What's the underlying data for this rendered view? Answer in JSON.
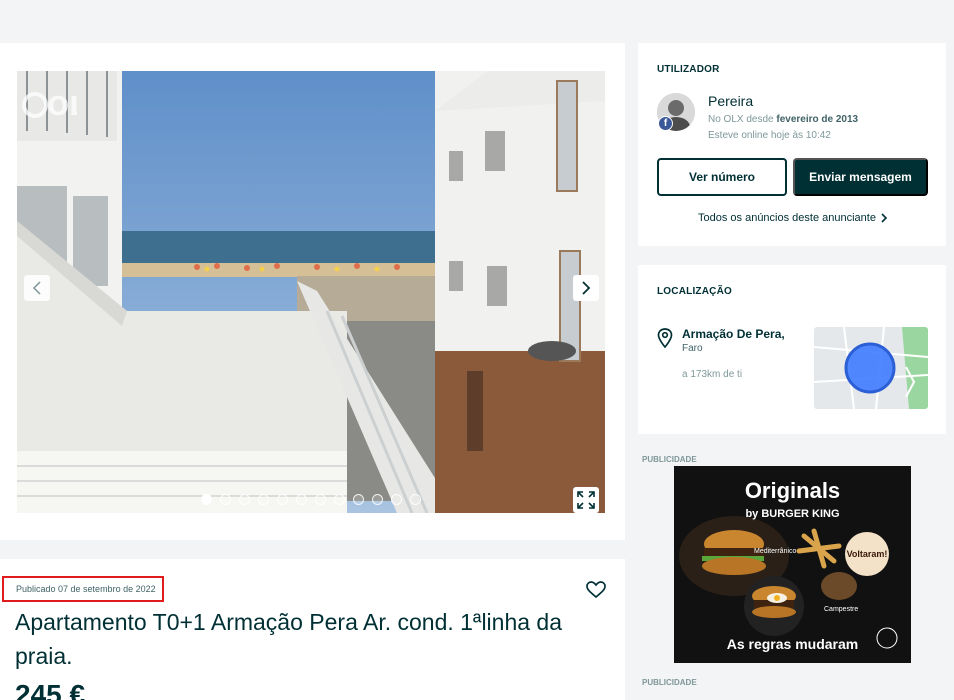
{
  "gallery": {
    "watermark": "OLX",
    "photo_count": 12,
    "active_photo_index": 0
  },
  "details": {
    "published": "Publicado 07 de setembro de 2022",
    "title": "Apartamento T0+1 Armação Pera Ar. cond. 1ªlinha da praia.",
    "price": "245 €"
  },
  "user": {
    "section_title": "UTILIZADOR",
    "name": "Pereira",
    "since_prefix": "No OLX desde",
    "since_date": "fevereiro de 2013",
    "online": "Esteve online hoje às 10:42",
    "social_badge": "f",
    "btn_number": "Ver número",
    "btn_message": "Enviar mensagem",
    "all_ads_link": "Todos os anúncios deste anunciante"
  },
  "location": {
    "section_title": "LOCALIZAÇÃO",
    "city": "Armação De Pera,",
    "region": "Faro",
    "distance": "a 173km de ti"
  },
  "advertising": {
    "label": "PUBLICIDADE",
    "headline": "Originals",
    "brand": "by BURGER KING",
    "badge": "Voltaram!",
    "item_1": "Mediterrânico",
    "item_2": "Campestre",
    "tagline": "As regras mudaram"
  },
  "colors": {
    "primary": "#002f34",
    "highlight_border": "#e01b1b",
    "page_background": "#f2f4f5",
    "facebook": "#3b5998"
  }
}
